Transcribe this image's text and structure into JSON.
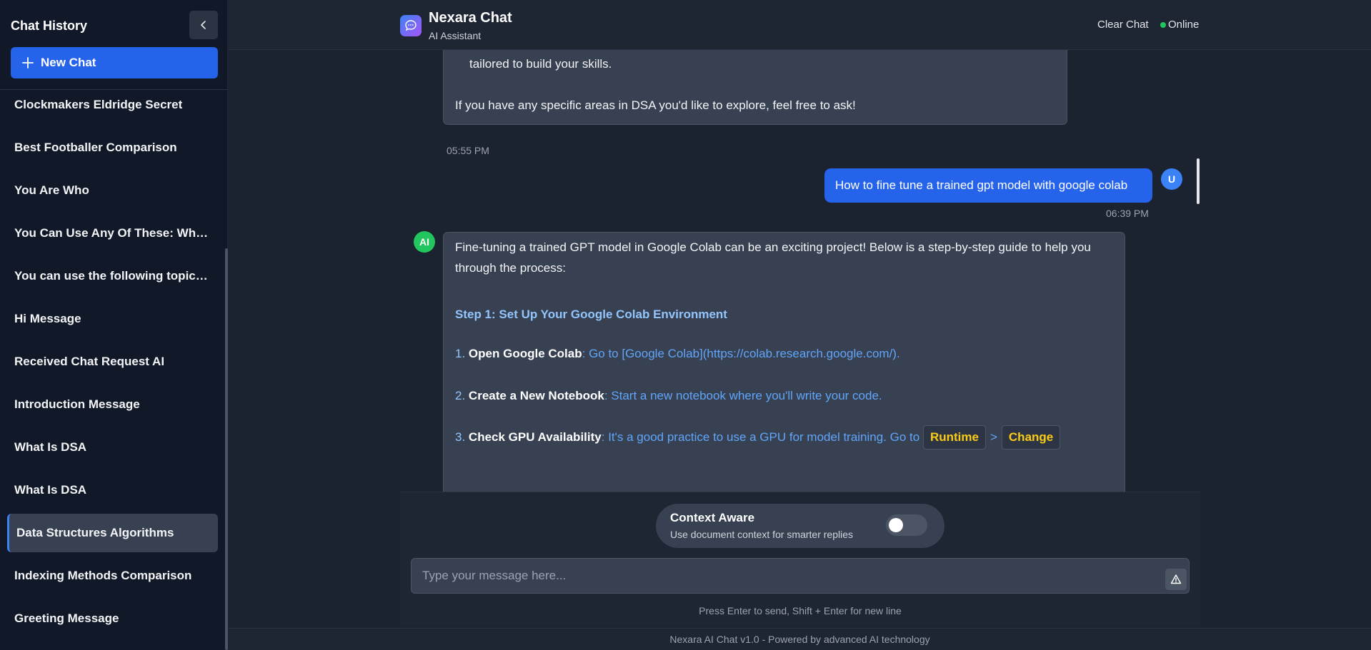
{
  "sidebar": {
    "title": "Chat History",
    "new_chat_label": "New Chat",
    "items": [
      {
        "label": "Clockmakers Eldridge Secret"
      },
      {
        "label": "Best Footballer Comparison"
      },
      {
        "label": "You Are Who"
      },
      {
        "label": "You Can Use Any Of These: Who ..."
      },
      {
        "label": "You can use the following topic ..."
      },
      {
        "label": "Hi Message"
      },
      {
        "label": "Received Chat Request AI"
      },
      {
        "label": "Introduction Message"
      },
      {
        "label": "What Is DSA"
      },
      {
        "label": "What Is DSA"
      },
      {
        "label": "Data Structures Algorithms"
      },
      {
        "label": "Indexing Methods Comparison"
      },
      {
        "label": "Greeting Message"
      }
    ],
    "active_index": 10
  },
  "header": {
    "app_name": "Nexara Chat",
    "subtitle": "AI Assistant",
    "clear_chat": "Clear Chat",
    "status": "Online"
  },
  "messages": {
    "ai_prev": {
      "line1": "tailored to build your skills.",
      "line2": "If you have any specific areas in DSA you'd like to explore, feel free to ask!",
      "time": "05:55 PM"
    },
    "user": {
      "avatar": "U",
      "text": "How to fine tune a trained gpt model with google colab",
      "time": "06:39 PM"
    },
    "ai": {
      "avatar": "AI",
      "intro_line1": "Fine-tuning a trained GPT model in Google Colab can be an exciting project! Below is a step-by-step guide to help you",
      "intro_line2": "through the process:",
      "step1_heading": "Step 1: Set Up Your Google Colab Environment",
      "item1_num": "1.",
      "item1_title": "Open Google Colab",
      "item1_text": "Go to [Google Colab](https://colab.research.google.com/).",
      "item2_num": "2.",
      "item2_title": "Create a New Notebook",
      "item2_text": "Start a new notebook where you'll write your code.",
      "item3_num": "3.",
      "item3_title": "Check GPU Availability",
      "item3_text": "It's a good practice to use a GPU for model training. Go to",
      "chip1": "Runtime",
      "chip_sep": ">",
      "chip2": "Change"
    }
  },
  "composer": {
    "context_title": "Context Aware",
    "context_sub": "Use document context for smarter replies",
    "context_enabled": false,
    "placeholder": "Type your message here...",
    "hint": "Press Enter to send, Shift + Enter for new line"
  },
  "footer": {
    "text": "Nexara AI Chat v1.0 - Powered by advanced AI technology"
  },
  "colors": {
    "accent": "#2563eb",
    "online": "#22c55e",
    "sidebar_bg": "#111827",
    "bubble_bg": "#374151"
  }
}
